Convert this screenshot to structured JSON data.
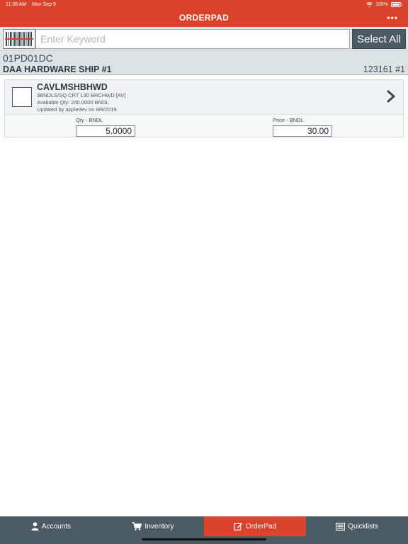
{
  "status_bar": {
    "time": "11:38 AM",
    "date": "Mon Sep 9",
    "battery": "100%"
  },
  "header": {
    "title": "ORDERPAD",
    "more_label": "•••"
  },
  "search": {
    "placeholder": "Enter Keyword",
    "value": "",
    "select_all_label": "Select All"
  },
  "account": {
    "code": "01PD01DC",
    "ship_to": "DAA HARDWARE SHIP #1",
    "ship_id": "123161 #1"
  },
  "item": {
    "code": "CAVLMSHBHWD",
    "description": "3BNDLS/SQ CRT L30  BRCHWD [AV]",
    "available": "Available Qty: 240.0000 BNDL",
    "updated": "Updated by appledev on 9/9/2019",
    "qty_label": "Qty - BNDL",
    "qty_value": "5.0000",
    "price_label": "Price - BNDL",
    "price_value": "30.00",
    "checked": false
  },
  "tabs": [
    {
      "label": "Accounts",
      "icon": "user-icon",
      "active": false
    },
    {
      "label": "Inventory",
      "icon": "cart-icon",
      "active": false
    },
    {
      "label": "OrderPad",
      "icon": "edit-icon",
      "active": true
    },
    {
      "label": "Quicklists",
      "icon": "list-icon",
      "active": false
    }
  ],
  "colors": {
    "accent": "#d9432b",
    "dark": "#4b5b63",
    "light_bg": "#dde2e5"
  }
}
